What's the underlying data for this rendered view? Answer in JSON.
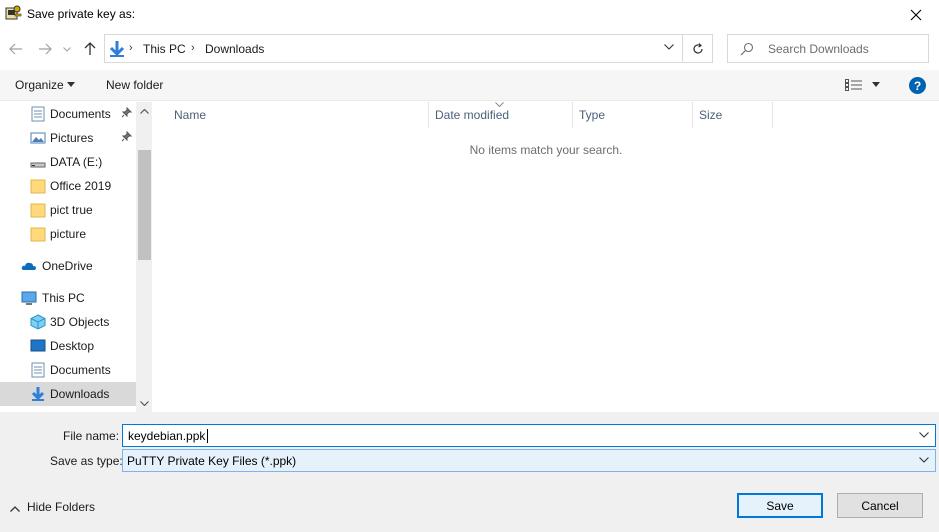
{
  "window": {
    "title": "Save private key as:",
    "close_label": "✕"
  },
  "nav": {
    "breadcrumb": [
      "This PC",
      "Downloads"
    ],
    "search_placeholder": "Search Downloads"
  },
  "toolbar": {
    "organize": "Organize",
    "new_folder": "New folder",
    "help": "?"
  },
  "sidebar": {
    "items": [
      {
        "label": "Documents",
        "icon": "documents-icon",
        "pinned": true
      },
      {
        "label": "Pictures",
        "icon": "pictures-icon",
        "pinned": true
      },
      {
        "label": "DATA (E:)",
        "icon": "drive-icon",
        "pinned": false
      },
      {
        "label": "Office 2019",
        "icon": "folder-icon",
        "pinned": false
      },
      {
        "label": "pict true",
        "icon": "folder-icon",
        "pinned": false
      },
      {
        "label": "picture",
        "icon": "folder-icon",
        "pinned": false
      },
      {
        "label": "OneDrive",
        "icon": "onedrive-icon",
        "pinned": false
      },
      {
        "label": "This PC",
        "icon": "this-pc-icon",
        "pinned": false
      },
      {
        "label": "3D Objects",
        "icon": "3d-objects-icon",
        "pinned": false
      },
      {
        "label": "Desktop",
        "icon": "desktop-icon",
        "pinned": false
      },
      {
        "label": "Documents",
        "icon": "documents-icon",
        "pinned": false
      },
      {
        "label": "Downloads",
        "icon": "downloads-icon",
        "pinned": false,
        "selected": true
      }
    ]
  },
  "filelist": {
    "columns": [
      "Name",
      "Date modified",
      "Type",
      "Size"
    ],
    "empty_message": "No items match your search."
  },
  "form": {
    "file_name_label": "File name:",
    "file_name_value": "keydebian.ppk",
    "save_type_label": "Save as type:",
    "save_type_value": "PuTTY Private Key Files (*.ppk)"
  },
  "footer": {
    "hide_folders": "Hide Folders",
    "save": "Save",
    "cancel": "Cancel"
  },
  "colors": {
    "accent": "#0078d7",
    "selected_bg": "#d9d9d9",
    "help_bg": "#0063b1"
  }
}
